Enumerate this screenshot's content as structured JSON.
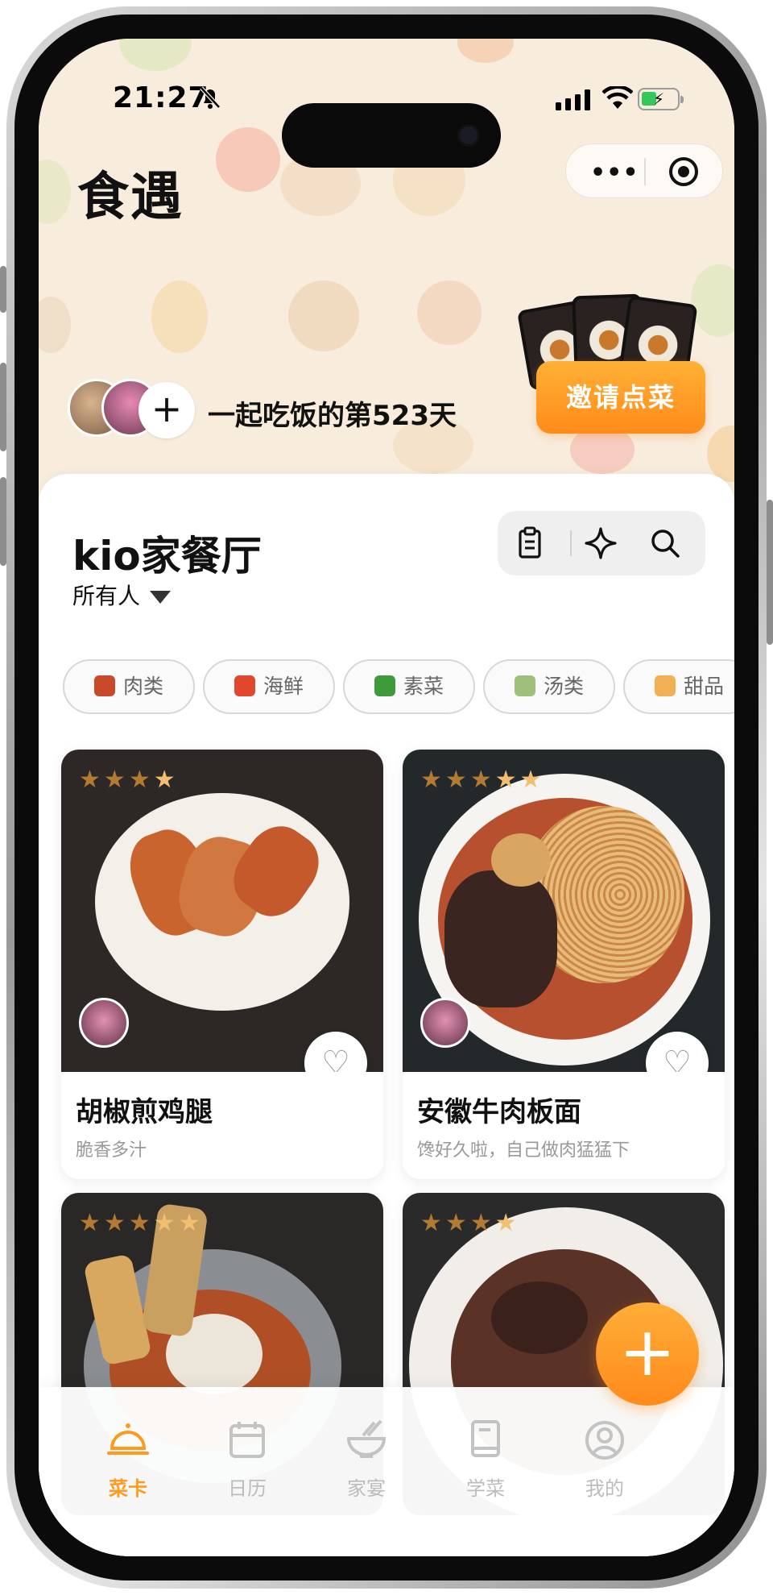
{
  "status_bar": {
    "time": "21:27"
  },
  "header": {
    "app_title": "食遇",
    "days_text": "一起吃饭的第523天",
    "invite_label": "邀请点菜"
  },
  "restaurant": {
    "name": "kio家餐厅",
    "filter_label": "所有人"
  },
  "categories": [
    {
      "label": "肉类",
      "icon": "meat-icon",
      "color": "#c94a2a"
    },
    {
      "label": "海鲜",
      "icon": "lobster-icon",
      "color": "#e0472c"
    },
    {
      "label": "素菜",
      "icon": "greens-icon",
      "color": "#3f9a3c"
    },
    {
      "label": "汤类",
      "icon": "soup-icon",
      "color": "#9fbf7a"
    },
    {
      "label": "甜品",
      "icon": "cake-icon",
      "color": "#f2b054"
    }
  ],
  "dishes": [
    {
      "name": "胡椒煎鸡腿",
      "desc": "脆香多汁",
      "stars": 4,
      "liked": false
    },
    {
      "name": "安徽牛肉板面",
      "desc": "馋好久啦，自己做肉猛猛下",
      "stars": 5,
      "liked": false
    },
    {
      "name": "",
      "desc": "",
      "stars": 5,
      "liked": false
    },
    {
      "name": "",
      "desc": "",
      "stars": 4,
      "liked": false
    }
  ],
  "tabbar": [
    {
      "label": "菜卡",
      "icon": "cloche-icon",
      "active": true
    },
    {
      "label": "日历",
      "icon": "calendar-icon",
      "active": false
    },
    {
      "label": "家宴",
      "icon": "bowl-icon",
      "active": false
    },
    {
      "label": "学菜",
      "icon": "book-icon",
      "active": false
    },
    {
      "label": "我的",
      "icon": "profile-icon",
      "active": false
    }
  ],
  "colors": {
    "accent": "#ff9a1f",
    "star_dark": "#b27a32",
    "star_light": "#f2be72",
    "hero_bg": "#f8ecdc"
  }
}
